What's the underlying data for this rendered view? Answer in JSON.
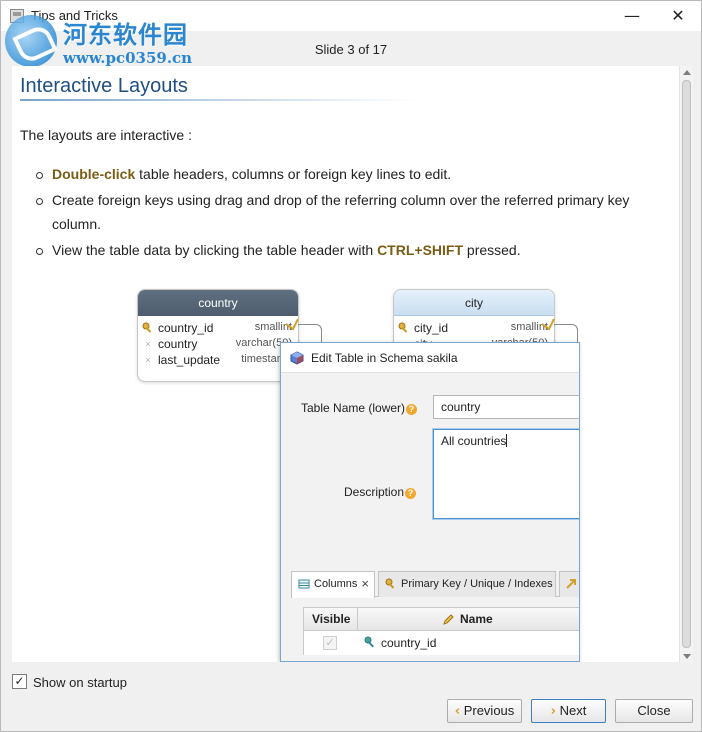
{
  "window": {
    "title": "Tips and Tricks",
    "minimize_glyph": "—",
    "maximize_glyph": "☐",
    "close_glyph": "✕"
  },
  "watermark": {
    "title": "河东软件园",
    "url": "www.pc0359.cn"
  },
  "slide_counter": "Slide 3 of 17",
  "slide": {
    "title": "Interactive Layouts",
    "intro": "The layouts are interactive :",
    "bullets": [
      {
        "highlight": "Double-click",
        "text": " table headers, columns or foreign key lines to edit."
      },
      {
        "text": "Create foreign keys using drag and drop of the referring column over the referred primary key column."
      },
      {
        "pre": "View the table data by clicking the table header with ",
        "highlight": "CTRL+SHIFT",
        "post": " pressed."
      }
    ]
  },
  "diagram": {
    "country_table": {
      "name": "country",
      "columns": [
        {
          "name": "country_id",
          "type": "smallint",
          "icon": "key-icon"
        },
        {
          "name": "country",
          "type": "varchar(50)",
          "icon": "nullable-icon"
        },
        {
          "name": "last_update",
          "type": "timestamp",
          "icon": "nullable-icon"
        }
      ]
    },
    "city_table": {
      "name": "city",
      "columns": [
        {
          "name": "city_id",
          "type": "smallint",
          "icon": "key-icon"
        },
        {
          "name": "city",
          "type": "varchar(50)",
          "icon": "nullable-icon"
        }
      ]
    }
  },
  "edit_dialog": {
    "title": "Edit Table in Schema sakila",
    "table_name_label": "Table Name (lower)",
    "table_name_value": "country",
    "description_label": "Description",
    "description_value": "All countries",
    "help_glyph": "?",
    "tabs": [
      {
        "label": "Columns",
        "icon": "columns-icon",
        "active": true
      },
      {
        "label": "Primary Key / Unique / Indexes",
        "icon": "key-icon",
        "active": false
      }
    ],
    "grid": {
      "headers": {
        "visible": "Visible",
        "name": "Name"
      },
      "rows": [
        {
          "name": "country_id",
          "visible": true,
          "icon": "key-icon"
        }
      ]
    }
  },
  "footer": {
    "show_on_startup_label": "Show on startup",
    "show_on_startup_checked": true,
    "previous_label": "Previous",
    "next_label": "Next",
    "close_label": "Close"
  },
  "colors": {
    "title_blue": "#1f4f83",
    "highlight_brown": "#7a5d14",
    "entity_dark_header": "#55657a",
    "entity_light_header": "#d6e7f6",
    "dialog_focus": "#4e8fd0"
  }
}
